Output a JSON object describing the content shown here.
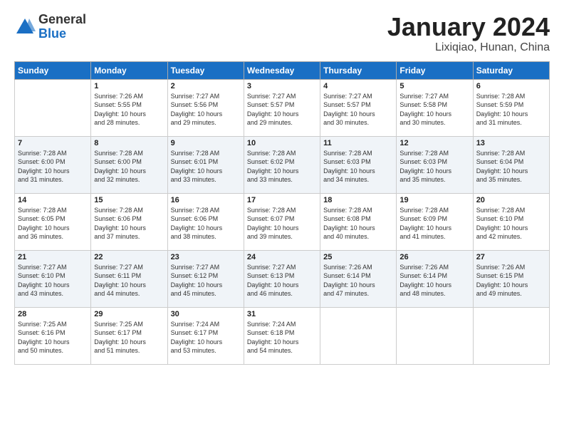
{
  "header": {
    "logo_general": "General",
    "logo_blue": "Blue",
    "title": "January 2024",
    "location": "Lixiqiao, Hunan, China"
  },
  "days_of_week": [
    "Sunday",
    "Monday",
    "Tuesday",
    "Wednesday",
    "Thursday",
    "Friday",
    "Saturday"
  ],
  "weeks": [
    [
      {
        "day": "",
        "info": ""
      },
      {
        "day": "1",
        "info": "Sunrise: 7:26 AM\nSunset: 5:55 PM\nDaylight: 10 hours\nand 28 minutes."
      },
      {
        "day": "2",
        "info": "Sunrise: 7:27 AM\nSunset: 5:56 PM\nDaylight: 10 hours\nand 29 minutes."
      },
      {
        "day": "3",
        "info": "Sunrise: 7:27 AM\nSunset: 5:57 PM\nDaylight: 10 hours\nand 29 minutes."
      },
      {
        "day": "4",
        "info": "Sunrise: 7:27 AM\nSunset: 5:57 PM\nDaylight: 10 hours\nand 30 minutes."
      },
      {
        "day": "5",
        "info": "Sunrise: 7:27 AM\nSunset: 5:58 PM\nDaylight: 10 hours\nand 30 minutes."
      },
      {
        "day": "6",
        "info": "Sunrise: 7:28 AM\nSunset: 5:59 PM\nDaylight: 10 hours\nand 31 minutes."
      }
    ],
    [
      {
        "day": "7",
        "info": "Sunrise: 7:28 AM\nSunset: 6:00 PM\nDaylight: 10 hours\nand 31 minutes."
      },
      {
        "day": "8",
        "info": "Sunrise: 7:28 AM\nSunset: 6:00 PM\nDaylight: 10 hours\nand 32 minutes."
      },
      {
        "day": "9",
        "info": "Sunrise: 7:28 AM\nSunset: 6:01 PM\nDaylight: 10 hours\nand 33 minutes."
      },
      {
        "day": "10",
        "info": "Sunrise: 7:28 AM\nSunset: 6:02 PM\nDaylight: 10 hours\nand 33 minutes."
      },
      {
        "day": "11",
        "info": "Sunrise: 7:28 AM\nSunset: 6:03 PM\nDaylight: 10 hours\nand 34 minutes."
      },
      {
        "day": "12",
        "info": "Sunrise: 7:28 AM\nSunset: 6:03 PM\nDaylight: 10 hours\nand 35 minutes."
      },
      {
        "day": "13",
        "info": "Sunrise: 7:28 AM\nSunset: 6:04 PM\nDaylight: 10 hours\nand 35 minutes."
      }
    ],
    [
      {
        "day": "14",
        "info": "Sunrise: 7:28 AM\nSunset: 6:05 PM\nDaylight: 10 hours\nand 36 minutes."
      },
      {
        "day": "15",
        "info": "Sunrise: 7:28 AM\nSunset: 6:06 PM\nDaylight: 10 hours\nand 37 minutes."
      },
      {
        "day": "16",
        "info": "Sunrise: 7:28 AM\nSunset: 6:06 PM\nDaylight: 10 hours\nand 38 minutes."
      },
      {
        "day": "17",
        "info": "Sunrise: 7:28 AM\nSunset: 6:07 PM\nDaylight: 10 hours\nand 39 minutes."
      },
      {
        "day": "18",
        "info": "Sunrise: 7:28 AM\nSunset: 6:08 PM\nDaylight: 10 hours\nand 40 minutes."
      },
      {
        "day": "19",
        "info": "Sunrise: 7:28 AM\nSunset: 6:09 PM\nDaylight: 10 hours\nand 41 minutes."
      },
      {
        "day": "20",
        "info": "Sunrise: 7:28 AM\nSunset: 6:10 PM\nDaylight: 10 hours\nand 42 minutes."
      }
    ],
    [
      {
        "day": "21",
        "info": "Sunrise: 7:27 AM\nSunset: 6:10 PM\nDaylight: 10 hours\nand 43 minutes."
      },
      {
        "day": "22",
        "info": "Sunrise: 7:27 AM\nSunset: 6:11 PM\nDaylight: 10 hours\nand 44 minutes."
      },
      {
        "day": "23",
        "info": "Sunrise: 7:27 AM\nSunset: 6:12 PM\nDaylight: 10 hours\nand 45 minutes."
      },
      {
        "day": "24",
        "info": "Sunrise: 7:27 AM\nSunset: 6:13 PM\nDaylight: 10 hours\nand 46 minutes."
      },
      {
        "day": "25",
        "info": "Sunrise: 7:26 AM\nSunset: 6:14 PM\nDaylight: 10 hours\nand 47 minutes."
      },
      {
        "day": "26",
        "info": "Sunrise: 7:26 AM\nSunset: 6:14 PM\nDaylight: 10 hours\nand 48 minutes."
      },
      {
        "day": "27",
        "info": "Sunrise: 7:26 AM\nSunset: 6:15 PM\nDaylight: 10 hours\nand 49 minutes."
      }
    ],
    [
      {
        "day": "28",
        "info": "Sunrise: 7:25 AM\nSunset: 6:16 PM\nDaylight: 10 hours\nand 50 minutes."
      },
      {
        "day": "29",
        "info": "Sunrise: 7:25 AM\nSunset: 6:17 PM\nDaylight: 10 hours\nand 51 minutes."
      },
      {
        "day": "30",
        "info": "Sunrise: 7:24 AM\nSunset: 6:17 PM\nDaylight: 10 hours\nand 53 minutes."
      },
      {
        "day": "31",
        "info": "Sunrise: 7:24 AM\nSunset: 6:18 PM\nDaylight: 10 hours\nand 54 minutes."
      },
      {
        "day": "",
        "info": ""
      },
      {
        "day": "",
        "info": ""
      },
      {
        "day": "",
        "info": ""
      }
    ]
  ]
}
